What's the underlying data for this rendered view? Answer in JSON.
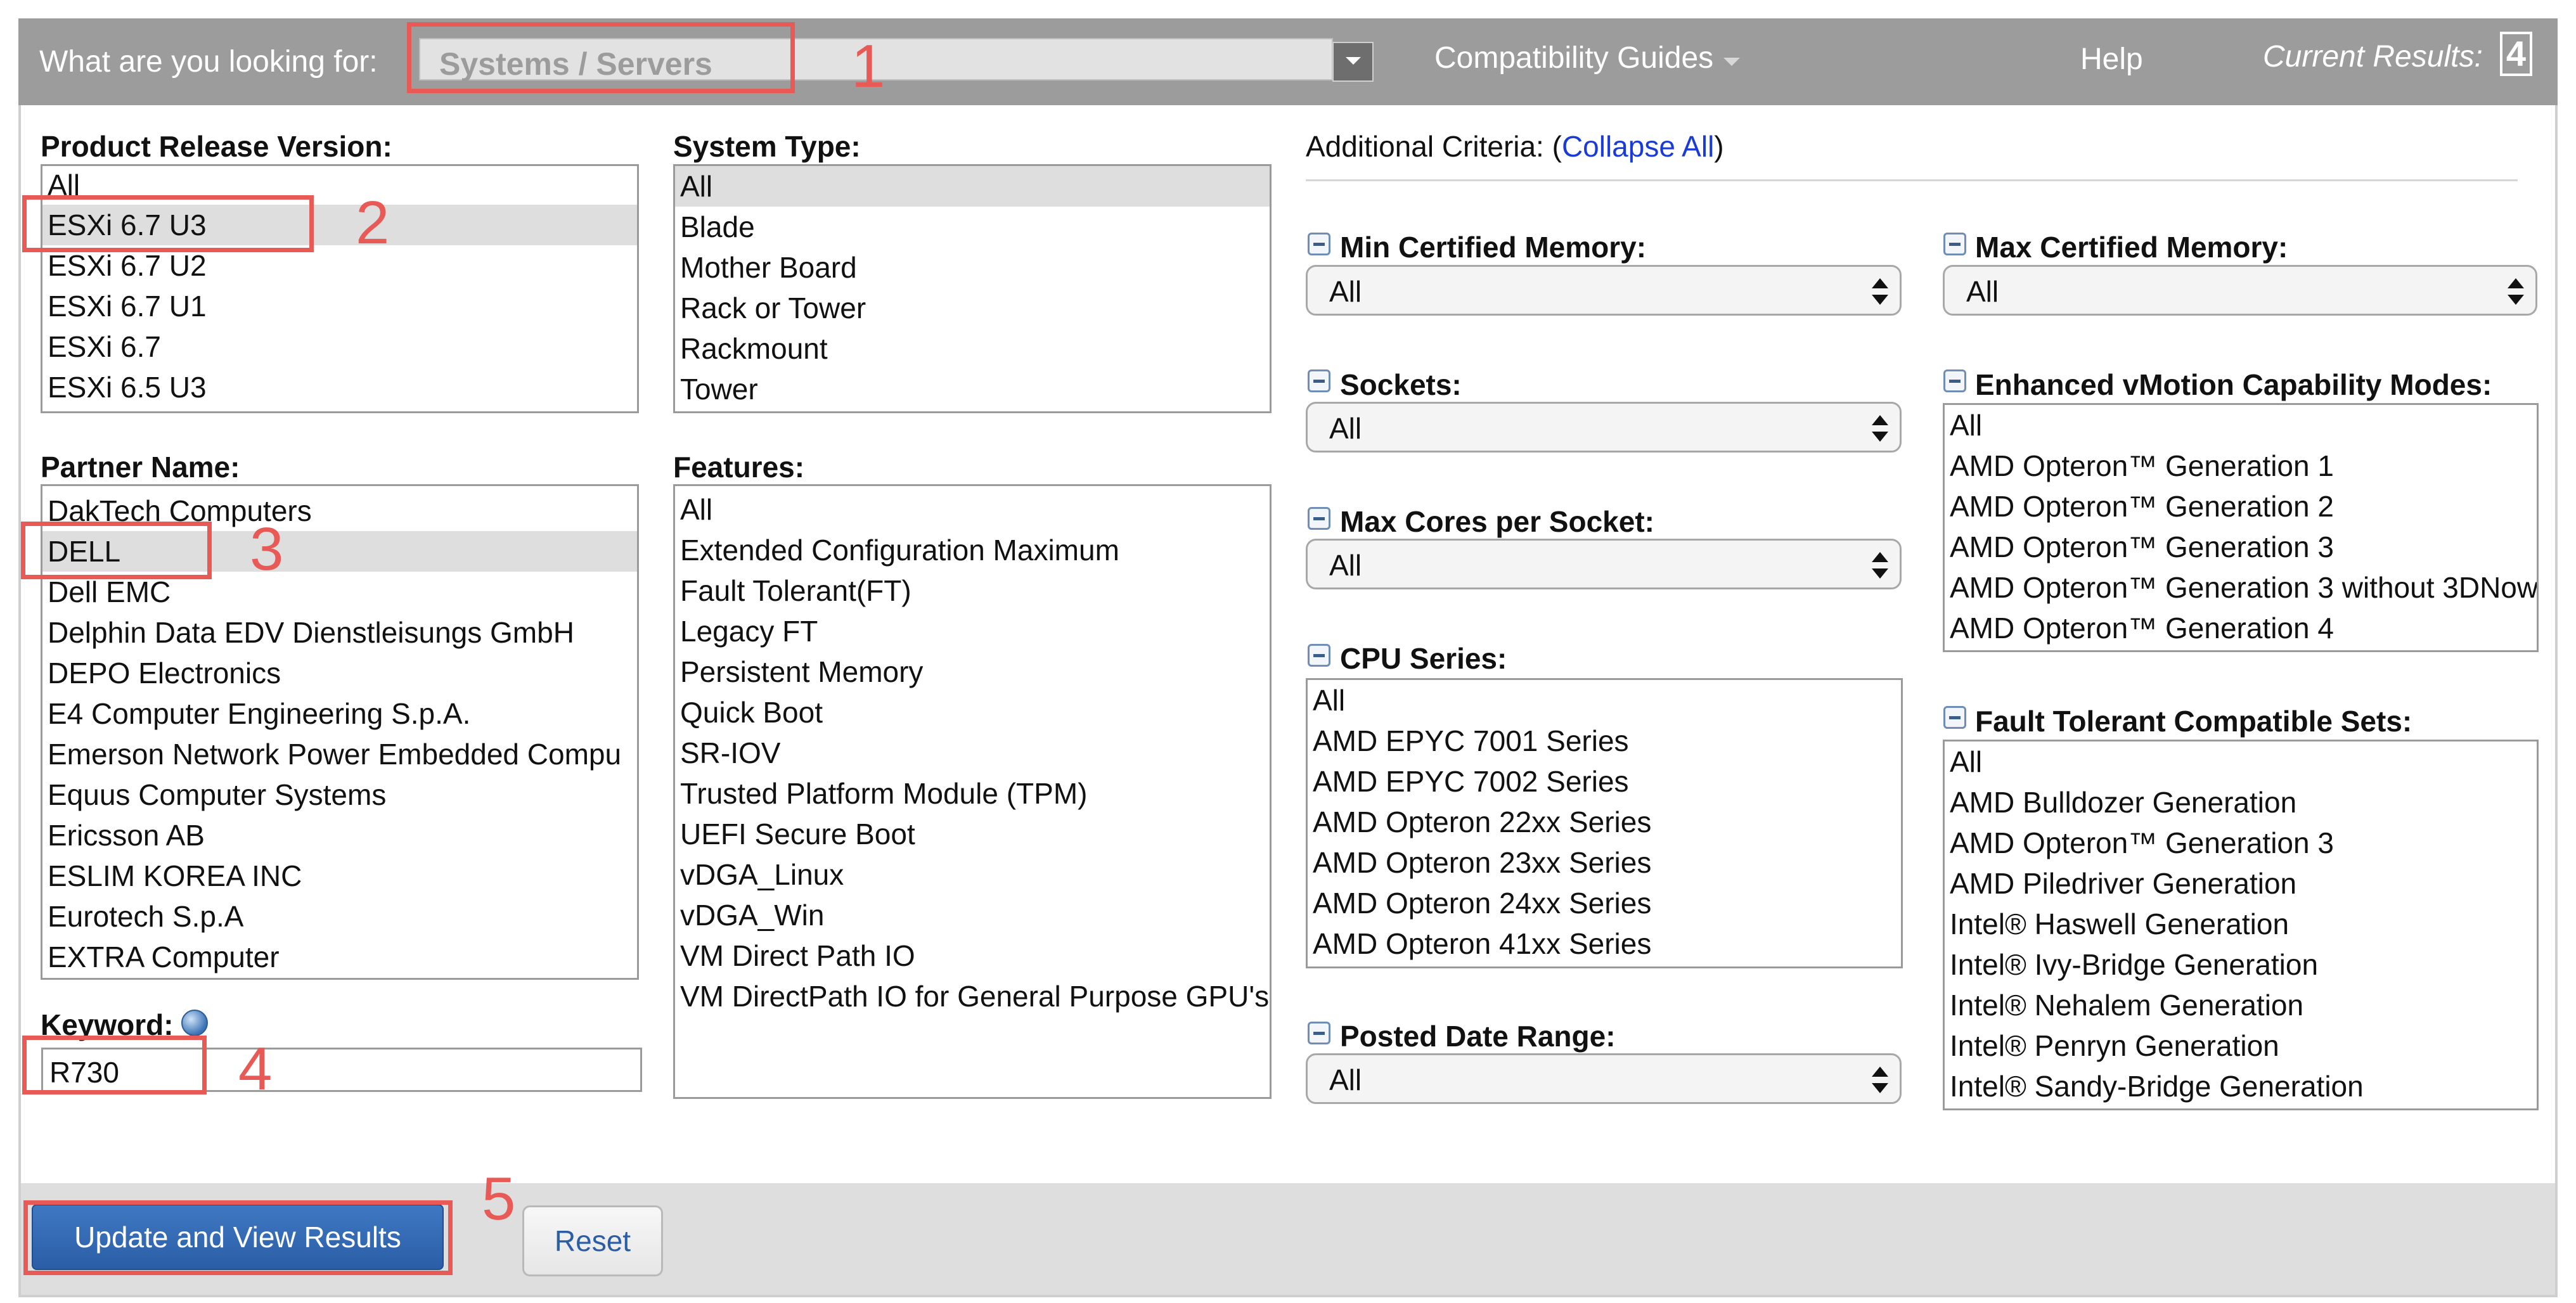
{
  "topbar": {
    "label": "What are you looking for:",
    "selected": "Systems / Servers",
    "guides": "Compatibility Guides",
    "help": "Help",
    "current_label": "Current Results:",
    "current_count": "4"
  },
  "release": {
    "heading": "Product Release Version:",
    "options": [
      "All",
      "ESXi 6.7 U3",
      "ESXi 6.7 U2",
      "ESXi 6.7 U1",
      "ESXi 6.7",
      "ESXi 6.5 U3"
    ],
    "selected": "ESXi 6.7 U3"
  },
  "system_type": {
    "heading": "System Type:",
    "options": [
      "All",
      "Blade",
      "Mother Board",
      "Rack or Tower",
      "Rackmount",
      "Tower"
    ],
    "selected": "All"
  },
  "partner": {
    "heading": "Partner Name:",
    "options": [
      "DakTech Computers",
      "DELL",
      "Dell EMC",
      "Delphin Data EDV Dienstleisungs GmbH",
      "DEPO Electronics",
      "E4 Computer Engineering S.p.A.",
      "Emerson Network Power Embedded Compu",
      "Equus Computer Systems",
      "Ericsson AB",
      "ESLIM KOREA INC",
      "Eurotech S.p.A",
      "EXTRA Computer"
    ],
    "selected": "DELL"
  },
  "features": {
    "heading": "Features:",
    "options": [
      "All",
      "Extended Configuration Maximum",
      "Fault Tolerant(FT)",
      "Legacy FT",
      "Persistent Memory",
      "Quick Boot",
      "SR-IOV",
      "Trusted Platform Module (TPM)",
      "UEFI Secure Boot",
      "vDGA_Linux",
      "vDGA_Win",
      "VM Direct Path IO",
      "VM DirectPath IO for General Purpose GPU's"
    ]
  },
  "keyword": {
    "label": "Keyword:",
    "value": "R730"
  },
  "additional": {
    "prefix": "Additional Criteria: (",
    "link": "Collapse All",
    "suffix": ")"
  },
  "min_memory": {
    "heading": "Min Certified Memory:",
    "value": "All"
  },
  "max_memory": {
    "heading": "Max Certified Memory:",
    "value": "All"
  },
  "sockets": {
    "heading": "Sockets:",
    "value": "All"
  },
  "max_cores": {
    "heading": "Max Cores per Socket:",
    "value": "All"
  },
  "posted_date": {
    "heading": "Posted Date Range:",
    "value": "All"
  },
  "cpu_series": {
    "heading": "CPU Series:",
    "options": [
      "All",
      "AMD EPYC 7001 Series",
      "AMD EPYC 7002 Series",
      "AMD Opteron 22xx Series",
      "AMD Opteron 23xx Series",
      "AMD Opteron 24xx Series",
      "AMD Opteron 41xx Series"
    ]
  },
  "evc": {
    "heading": "Enhanced vMotion Capability Modes:",
    "options": [
      "All",
      "AMD Opteron™ Generation 1",
      "AMD Opteron™ Generation 2",
      "AMD Opteron™ Generation 3",
      "AMD Opteron™ Generation 3 without 3DNow",
      "AMD Opteron™ Generation 4"
    ]
  },
  "ft_sets": {
    "heading": "Fault Tolerant Compatible Sets:",
    "options": [
      "All",
      "AMD Bulldozer Generation",
      "AMD Opteron™ Generation 3",
      "AMD Piledriver Generation",
      "Intel® Haswell Generation",
      "Intel® Ivy-Bridge Generation",
      "Intel® Nehalem Generation",
      "Intel® Penryn Generation",
      "Intel® Sandy-Bridge Generation"
    ]
  },
  "buttons": {
    "update": "Update and View Results",
    "reset": "Reset"
  },
  "annotations": [
    "1",
    "2",
    "3",
    "4",
    "5"
  ],
  "colors": {
    "topbar": "#9c9c9c",
    "annotation": "#e85a55",
    "primary_button": "#2f66b0",
    "link": "#1a3bd6"
  }
}
